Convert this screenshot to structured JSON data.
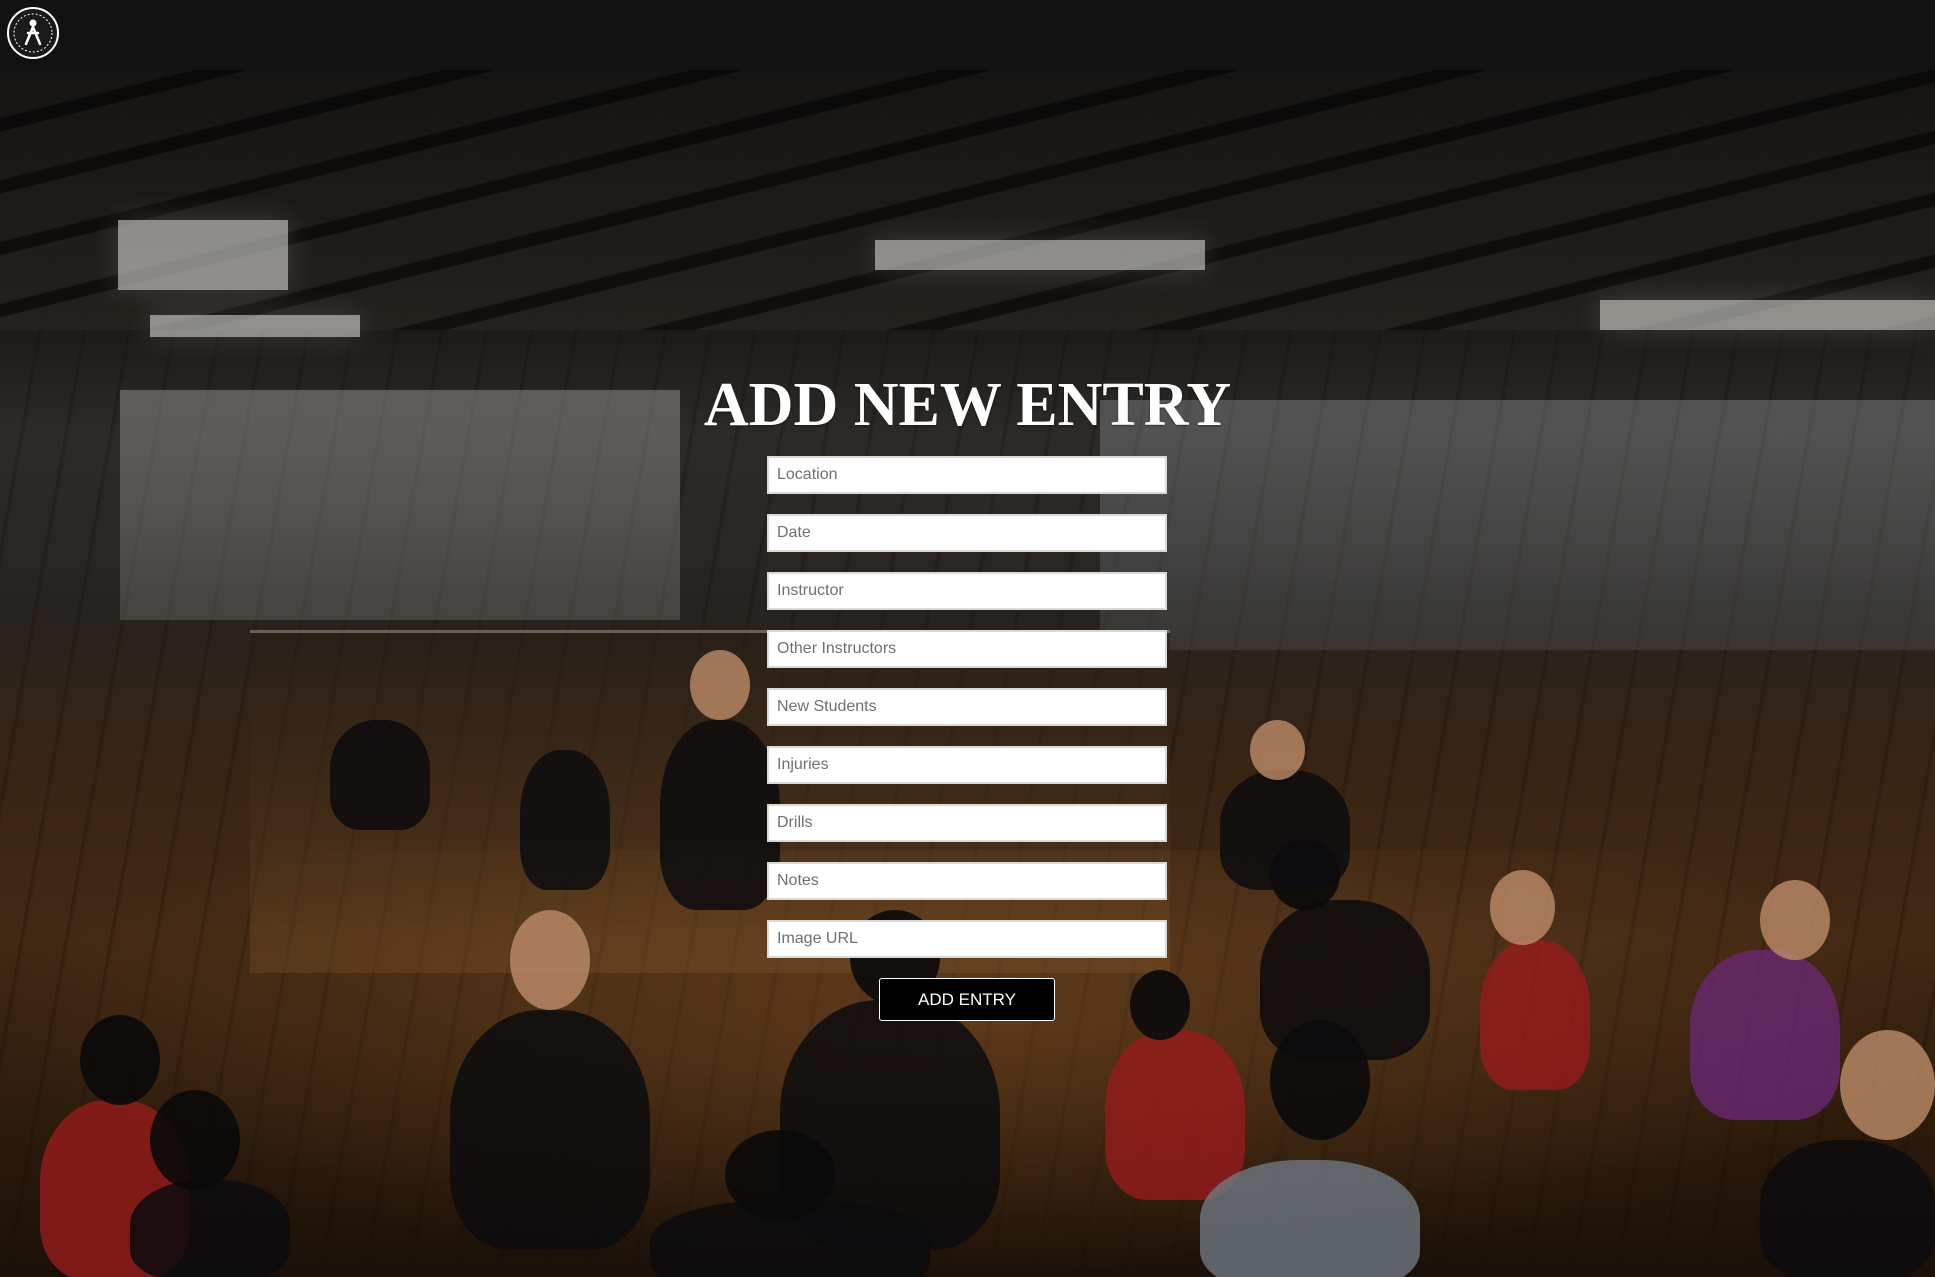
{
  "header": {
    "logo_icon": "wing-chun-emblem-icon"
  },
  "page": {
    "title": "ADD NEW ENTRY"
  },
  "form": {
    "fields": [
      {
        "name": "location",
        "placeholder": "Location",
        "value": ""
      },
      {
        "name": "date",
        "placeholder": "Date",
        "value": ""
      },
      {
        "name": "instructor",
        "placeholder": "Instructor",
        "value": ""
      },
      {
        "name": "other_instructors",
        "placeholder": "Other Instructors",
        "value": ""
      },
      {
        "name": "new_students",
        "placeholder": "New Students",
        "value": ""
      },
      {
        "name": "injuries",
        "placeholder": "Injuries",
        "value": ""
      },
      {
        "name": "drills",
        "placeholder": "Drills",
        "value": ""
      },
      {
        "name": "notes",
        "placeholder": "Notes",
        "value": ""
      },
      {
        "name": "image_url",
        "placeholder": "Image URL",
        "value": ""
      }
    ],
    "submit_label": "ADD ENTRY"
  },
  "colors": {
    "topbar": "#121212",
    "button_bg": "#000000",
    "button_text": "#ffffff",
    "title_text": "#ffffff"
  }
}
